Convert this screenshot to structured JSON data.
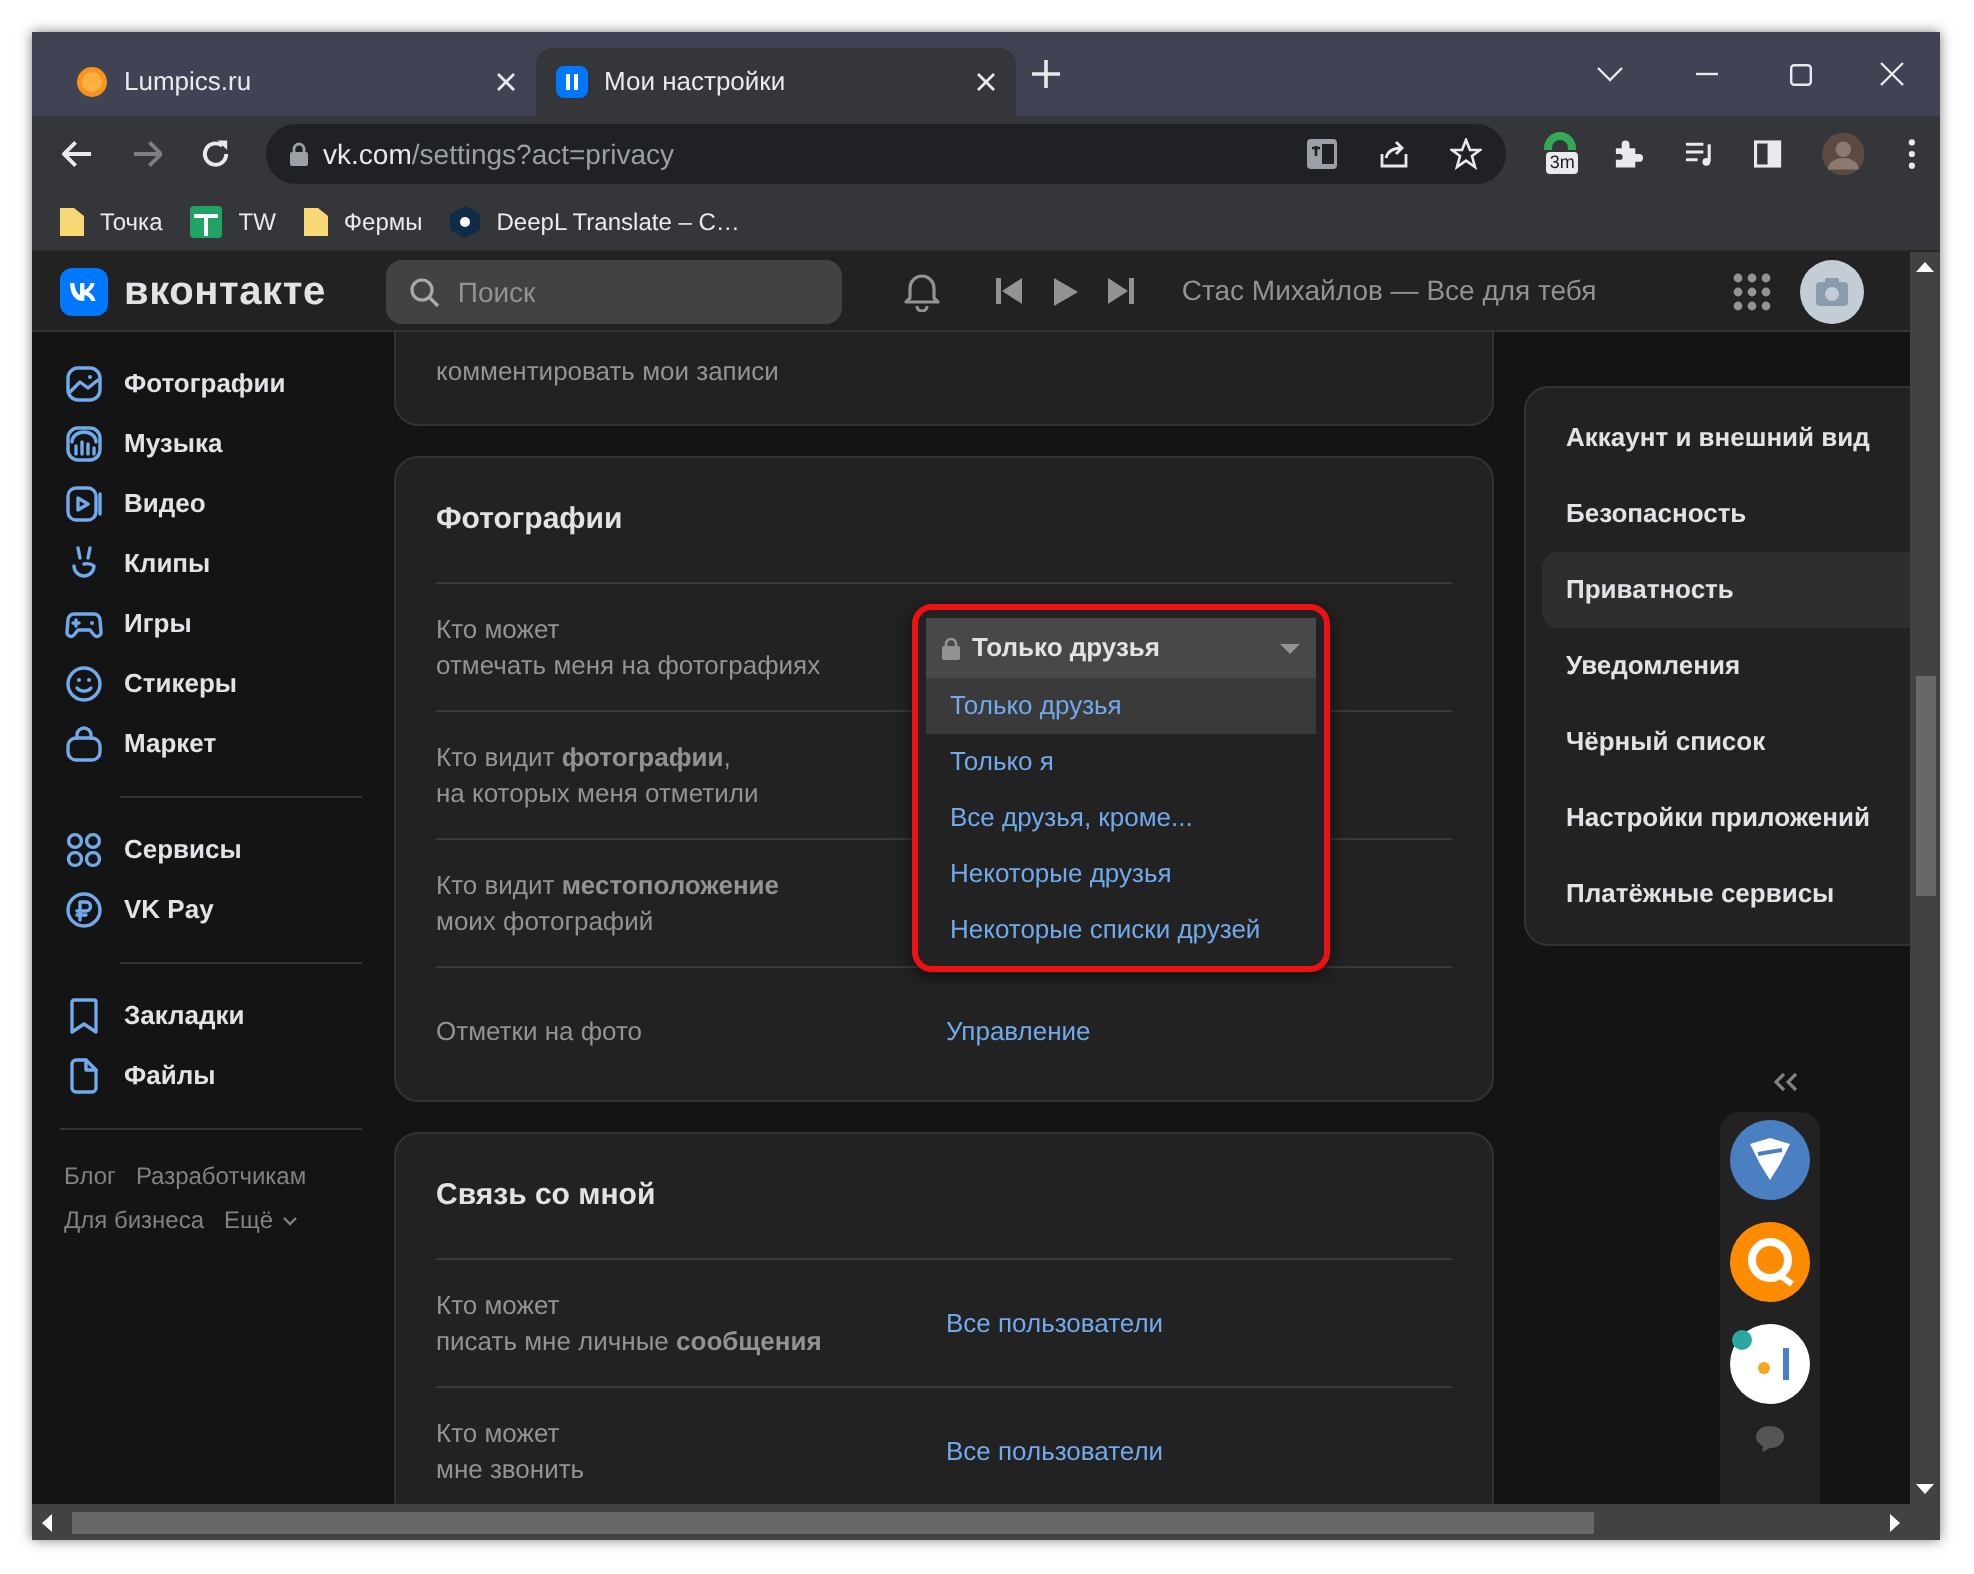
{
  "browser": {
    "tabs": [
      {
        "title": "Lumpics.ru",
        "selected": false,
        "kind": "site"
      },
      {
        "title": "Мои настройки",
        "selected": true,
        "kind": "social"
      }
    ],
    "url": {
      "host": "vk.com",
      "path": "/settings?act=privacy"
    },
    "extension_badge": "3m",
    "bookmarks": [
      {
        "label": "Точка",
        "kind": "folder"
      },
      {
        "label": "TW",
        "kind": "sheet"
      },
      {
        "label": "Фермы",
        "kind": "folder"
      },
      {
        "label": "DeepL Translate – C…",
        "kind": "app"
      }
    ]
  },
  "header": {
    "logo": "вконтакте",
    "search": {
      "placeholder": "Поиск"
    },
    "now_playing": "Стас Михайлов — Все для тебя"
  },
  "sidebar": {
    "groups": [
      [
        {
          "label": "Фотографии"
        },
        {
          "label": "Музыка"
        },
        {
          "label": "Видео"
        },
        {
          "label": "Клипы"
        },
        {
          "label": "Игры"
        },
        {
          "label": "Стикеры"
        },
        {
          "label": "Маркет"
        }
      ],
      [
        {
          "label": "Сервисы"
        },
        {
          "label": "VK Pay"
        }
      ],
      [
        {
          "label": "Закладки"
        },
        {
          "label": "Файлы"
        }
      ]
    ],
    "footer": [
      "Блог",
      "Разработчикам",
      "Для бизнеса",
      "Ещё"
    ]
  },
  "settings": {
    "partial_card": {
      "label": "комментировать мои записи"
    },
    "cards": [
      {
        "title": "Фотографии",
        "rows": [
          {
            "label": "Кто может\nотмечать меня на фотографиях"
          },
          {
            "label": "Кто видит **фотографии**,\nна которых меня отметили"
          },
          {
            "label": "Кто видит **местоположение**\nмоих фотографий"
          },
          {
            "label": "Отметки на фото",
            "value": "Управление"
          }
        ],
        "dropdown": {
          "value": "Только друзья",
          "options": [
            {
              "label": "Только друзья",
              "selected": true
            },
            {
              "label": "Только я",
              "selected": false
            },
            {
              "label": "Все друзья, кроме...",
              "selected": false
            },
            {
              "label": "Некоторые друзья",
              "selected": false
            },
            {
              "label": "Некоторые списки друзей",
              "selected": false
            }
          ]
        }
      },
      {
        "title": "Связь со мной",
        "rows": [
          {
            "label": "Кто может\nписать мне личные **сообщения**",
            "value": "Все пользователи"
          },
          {
            "label": "Кто может\nмне звонить",
            "value": "Все пользователи"
          }
        ]
      }
    ]
  },
  "settings_menu": [
    {
      "label": "Аккаунт и внешний вид",
      "selected": false
    },
    {
      "label": "Безопасность",
      "selected": false
    },
    {
      "label": "Приватность",
      "selected": true
    },
    {
      "label": "Уведомления",
      "selected": false
    },
    {
      "label": "Чёрный список",
      "selected": false
    },
    {
      "label": "Настройки приложений",
      "selected": false
    },
    {
      "label": "Платёжные сервисы",
      "selected": false
    }
  ]
}
